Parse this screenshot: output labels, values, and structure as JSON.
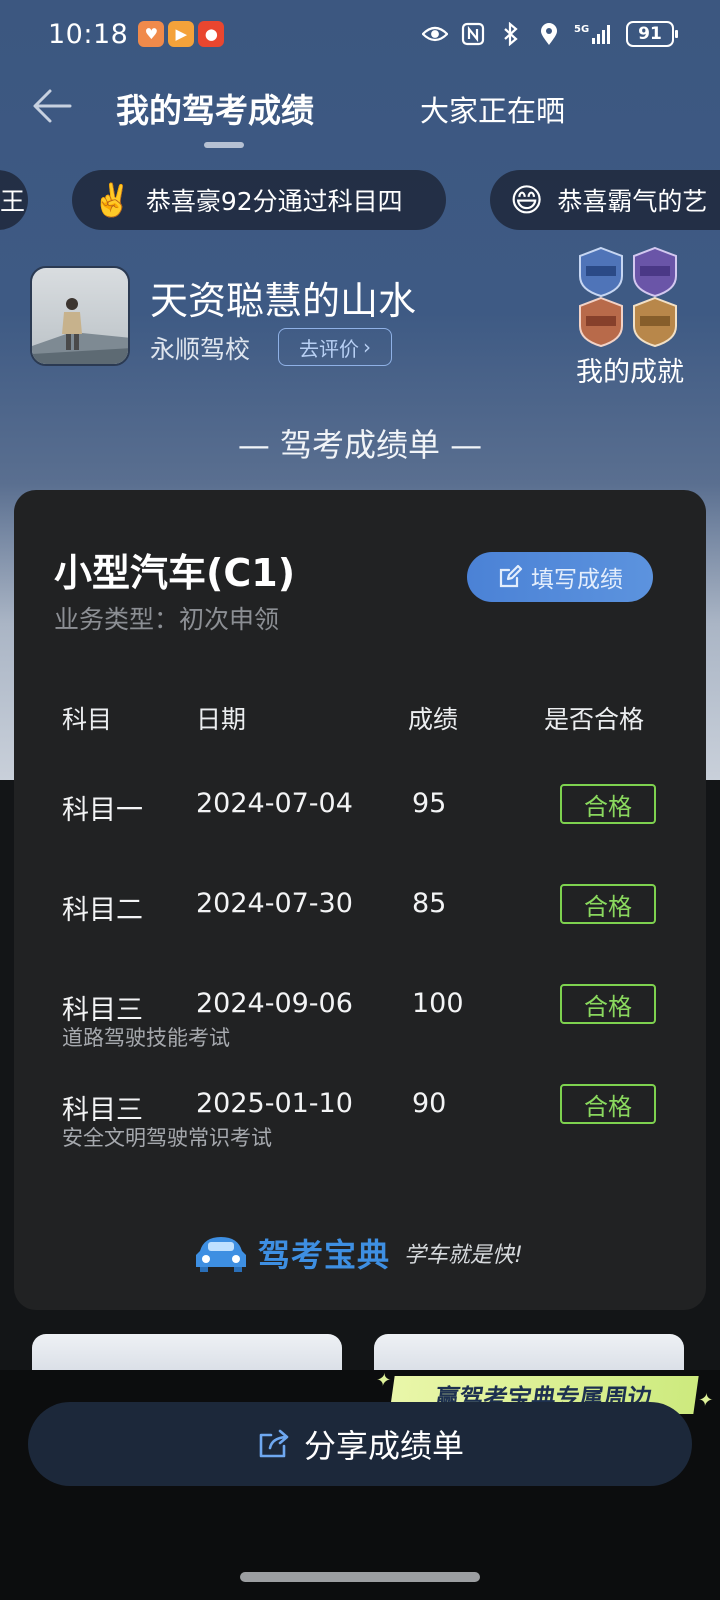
{
  "status_bar": {
    "time": "10:18",
    "network": "5G",
    "battery": "91"
  },
  "header": {
    "title": "我的驾考成绩",
    "secondary_tab": "大家正在晒"
  },
  "marquee": {
    "items": [
      {
        "emoji": "",
        "text": "王"
      },
      {
        "emoji": "✌️",
        "text": "恭喜豪92分通过科目四"
      },
      {
        "emoji": "😄",
        "text": "恭喜霸气的艺"
      }
    ]
  },
  "profile": {
    "username": "天资聪慧的山水",
    "school": "永顺驾校",
    "rate_button": "去评价",
    "achievements_label": "我的成就"
  },
  "section_title": "— 驾考成绩单 —",
  "card": {
    "license": "小型汽车(C1)",
    "business_type": "业务类型：初次申领",
    "fill_button": "填写成绩",
    "columns": [
      "科目",
      "日期",
      "成绩",
      "是否合格"
    ],
    "rows": [
      {
        "subject": "科目一",
        "date": "2024-07-04",
        "score": "95",
        "result": "合格",
        "note": ""
      },
      {
        "subject": "科目二",
        "date": "2024-07-30",
        "score": "85",
        "result": "合格",
        "note": ""
      },
      {
        "subject": "科目三",
        "date": "2024-09-06",
        "score": "100",
        "result": "合格",
        "note": "道路驾驶技能考试"
      },
      {
        "subject": "科目三",
        "date": "2025-01-10",
        "score": "90",
        "result": "合格",
        "note": "安全文明驾驶常识考试"
      }
    ],
    "brand_name": "驾考宝典",
    "brand_slogan": "学车就是快!"
  },
  "promo": "赢驾考宝典专属周边",
  "share_button": "分享成绩单",
  "colors": {
    "header_bg": "#3e5a84",
    "card_bg": "#212223",
    "pass_green": "#7ed24f",
    "accent_blue": "#4b82d6"
  }
}
